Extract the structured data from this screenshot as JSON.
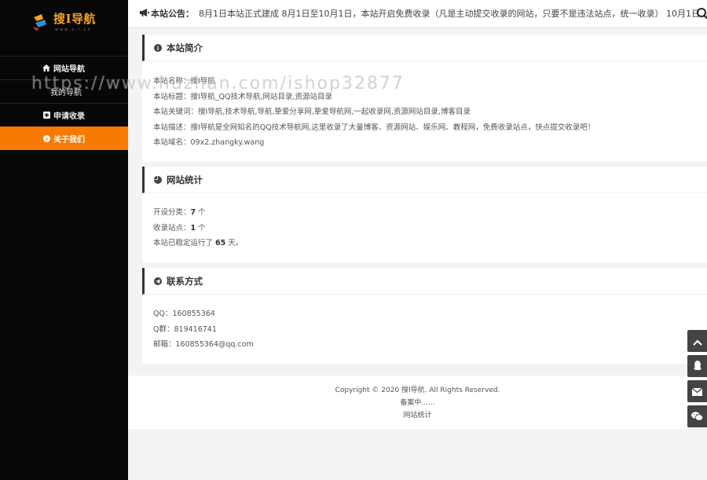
{
  "sidebar": {
    "logo_text": "搜I导航",
    "logo_sub": "www.s-i.cn",
    "items": [
      {
        "label": "网站导航",
        "icon": "home-icon"
      },
      {
        "label": "我的导航",
        "icon": "none"
      },
      {
        "label": "申请收录",
        "icon": "plus-square-icon"
      },
      {
        "label": "关于我们",
        "icon": "info-circle-icon"
      }
    ]
  },
  "announcement": {
    "title": "本站公告：",
    "text": "8月1日本站正式建成 8月1日至10月1日，本站开启免费收录（凡是主动提交收录的网站，只要不是违法站点，统一收录） 10月1日..."
  },
  "intro": {
    "title": "本站简介",
    "lines": [
      "本站名称：搜I导航",
      "本站标题：搜I导航_QQ技术导航,网站目录,资源站目录",
      "本站关键词：搜I导航,技术导航,导航,挚爱分享网,挚爱导航网,一起收录网,资源网站目录,博客目录",
      "本站描述：搜I导航是全网知名的QQ技术导航网,这里收录了大量博客、资源网站、娱乐网、教程网，免费收录站点，快点提交收录吧！",
      "本站域名：09x2.zhangky.wang"
    ]
  },
  "stats": {
    "title": "网站统计",
    "category_prefix": "开设分类：",
    "category_count": "7",
    "category_unit": " 个",
    "site_prefix": "收录站点：",
    "site_count": "1",
    "site_unit": " 个",
    "run_prefix": "本站已稳定运行了 ",
    "run_days": "65",
    "run_unit": " 天。"
  },
  "contact": {
    "title": "联系方式",
    "lines": [
      "QQ：160855364",
      "Q群：819416741",
      "邮箱：160855364@qq.com"
    ]
  },
  "footer": {
    "copyright": "Copyright © 2020 搜I导航. All Rights Reserved.",
    "beian": "备案中......",
    "stats_link": "网站统计"
  },
  "watermark": "https://www.huzhan.com/ishop32877",
  "colors": {
    "accent": "#f77a02",
    "sidebar_bg": "#070707",
    "tool_bg": "#444444"
  }
}
